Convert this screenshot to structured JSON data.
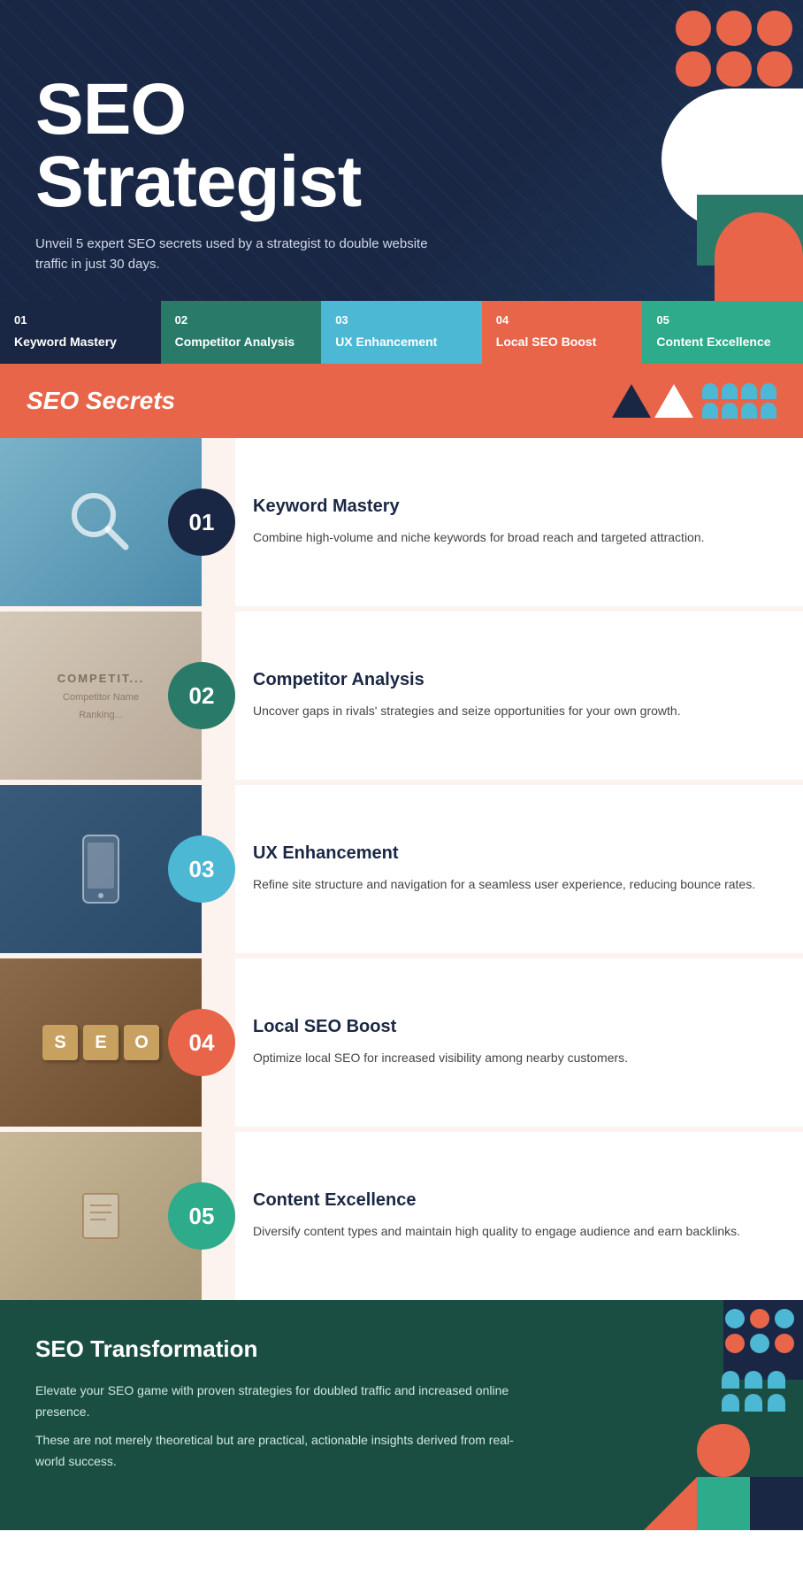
{
  "hero": {
    "title_line1": "SEO",
    "title_line2": "Strategist",
    "subtitle": "Unveil 5 expert SEO secrets used by a strategist to double website traffic in just 30 days."
  },
  "tabs": [
    {
      "num": "01",
      "label": "Keyword Mastery"
    },
    {
      "num": "02",
      "label": "Competitor Analysis"
    },
    {
      "num": "03",
      "label": "UX Enhancement"
    },
    {
      "num": "04",
      "label": "Local SEO Boost"
    },
    {
      "num": "05",
      "label": "Content Excellence"
    }
  ],
  "banner": {
    "title": "SEO Secrets"
  },
  "secrets": [
    {
      "num": "01",
      "heading": "Keyword Mastery",
      "desc": "Combine high-volume and niche keywords for broad reach and targeted attraction.",
      "img_type": "keyword"
    },
    {
      "num": "02",
      "heading": "Competitor Analysis",
      "desc": "Uncover gaps in rivals' strategies and seize opportunities for your own growth.",
      "img_type": "competitor"
    },
    {
      "num": "03",
      "heading": "UX Enhancement",
      "desc": "Refine site structure and navigation for a seamless user experience, reducing bounce rates.",
      "img_type": "ux"
    },
    {
      "num": "04",
      "heading": "Local SEO Boost",
      "desc": "Optimize local SEO for increased visibility among nearby customers.",
      "img_type": "seo"
    },
    {
      "num": "05",
      "heading": "Content Excellence",
      "desc": "Diversify content types and maintain high quality to engage audience and earn backlinks.",
      "img_type": "content"
    }
  ],
  "footer": {
    "title": "SEO Transformation",
    "text_line1": "Elevate your SEO game with proven strategies for doubled traffic and increased online presence.",
    "text_line2": "These are not merely theoretical but are practical, actionable insights derived from real-world success."
  }
}
